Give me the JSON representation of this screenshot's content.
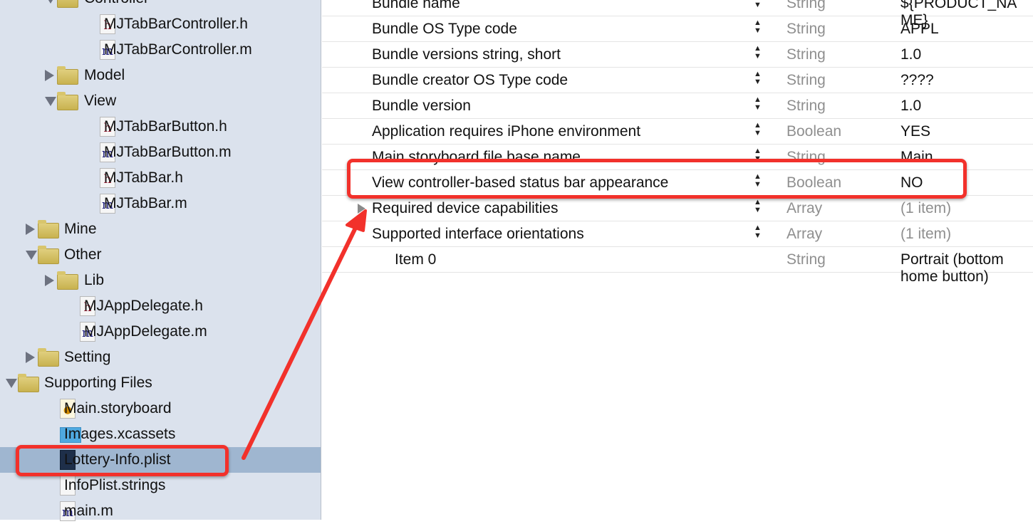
{
  "navigator": {
    "items": [
      {
        "label": "Controller",
        "kind": "folder",
        "expanded": true,
        "level": 2
      },
      {
        "label": "MJTabBarController.h",
        "kind": "h",
        "level": 3
      },
      {
        "label": "MJTabBarController.m",
        "kind": "m",
        "level": 3
      },
      {
        "label": "Model",
        "kind": "folder",
        "expanded": false,
        "level": 2
      },
      {
        "label": "View",
        "kind": "folder",
        "expanded": true,
        "level": 2
      },
      {
        "label": "MJTabBarButton.h",
        "kind": "h",
        "level": 3
      },
      {
        "label": "MJTabBarButton.m",
        "kind": "m",
        "level": 3
      },
      {
        "label": "MJTabBar.h",
        "kind": "h",
        "level": 3
      },
      {
        "label": "MJTabBar.m",
        "kind": "m",
        "level": 3
      },
      {
        "label": "Mine",
        "kind": "folder",
        "expanded": false,
        "level": 1
      },
      {
        "label": "Other",
        "kind": "folder",
        "expanded": true,
        "level": 1
      },
      {
        "label": "Lib",
        "kind": "folder",
        "expanded": false,
        "level": 2
      },
      {
        "label": "MJAppDelegate.h",
        "kind": "h",
        "level": 2
      },
      {
        "label": "MJAppDelegate.m",
        "kind": "m",
        "level": 2
      },
      {
        "label": "Setting",
        "kind": "folder",
        "expanded": false,
        "level": 1
      },
      {
        "label": "Supporting Files",
        "kind": "folder",
        "expanded": true,
        "level": 0
      },
      {
        "label": "Main.storyboard",
        "kind": "storyboard",
        "level": 1
      },
      {
        "label": "Images.xcassets",
        "kind": "xcassets",
        "level": 1
      },
      {
        "label": "Lottery-Info.plist",
        "kind": "plist",
        "level": 1,
        "selected": true
      },
      {
        "label": "InfoPlist.strings",
        "kind": "strings",
        "level": 1
      },
      {
        "label": "main.m",
        "kind": "m",
        "level": 1
      }
    ]
  },
  "plist": {
    "rows": [
      {
        "key": "Bundle name",
        "type": "String",
        "value": "${PRODUCT_NAME}"
      },
      {
        "key": "Bundle OS Type code",
        "type": "String",
        "value": "APPL"
      },
      {
        "key": "Bundle versions string, short",
        "type": "String",
        "value": "1.0"
      },
      {
        "key": "Bundle creator OS Type code",
        "type": "String",
        "value": "????"
      },
      {
        "key": "Bundle version",
        "type": "String",
        "value": "1.0"
      },
      {
        "key": "Application requires iPhone environment",
        "type": "Boolean",
        "value": "YES"
      },
      {
        "key": "Main storyboard file base name",
        "type": "String",
        "value": "Main"
      },
      {
        "key": "View controller-based status bar appearance",
        "type": "Boolean",
        "value": "NO",
        "highlighted": true
      },
      {
        "key": "Required device capabilities",
        "type": "Array",
        "value": "(1 item)",
        "collapsible": true
      },
      {
        "key": "Supported interface orientations",
        "type": "Array",
        "value": "(1 item)",
        "collapsible": true,
        "expanded": true
      },
      {
        "key": "Item 0",
        "type": "String",
        "value": "Portrait (bottom home button)",
        "child": true
      }
    ]
  },
  "colors": {
    "annotation": "#f2312b",
    "selection": "#9fb6d0",
    "sidebar": "#dbe2ed"
  }
}
